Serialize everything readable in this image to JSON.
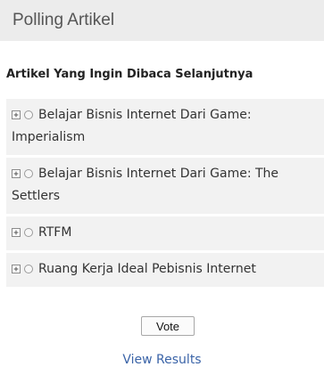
{
  "poll": {
    "header_title": "Polling Artikel",
    "question": "Artikel Yang Ingin Dibaca Selanjutnya",
    "answers": [
      {
        "label": "Belajar Bisnis Internet Dari Game: Imperialism"
      },
      {
        "label": "Belajar Bisnis Internet Dari Game: The Settlers"
      },
      {
        "label": "RTFM"
      },
      {
        "label": "Ruang Kerja Ideal Pebisnis Internet"
      }
    ],
    "vote_label": "Vote",
    "view_results_label": "View Results"
  },
  "icons": {
    "expand": "plus-square-icon",
    "radio": "radio-unselected"
  },
  "colors": {
    "header_bg": "#ececec",
    "answer_bg": "#f2f2f2",
    "link": "#3b64a8"
  }
}
